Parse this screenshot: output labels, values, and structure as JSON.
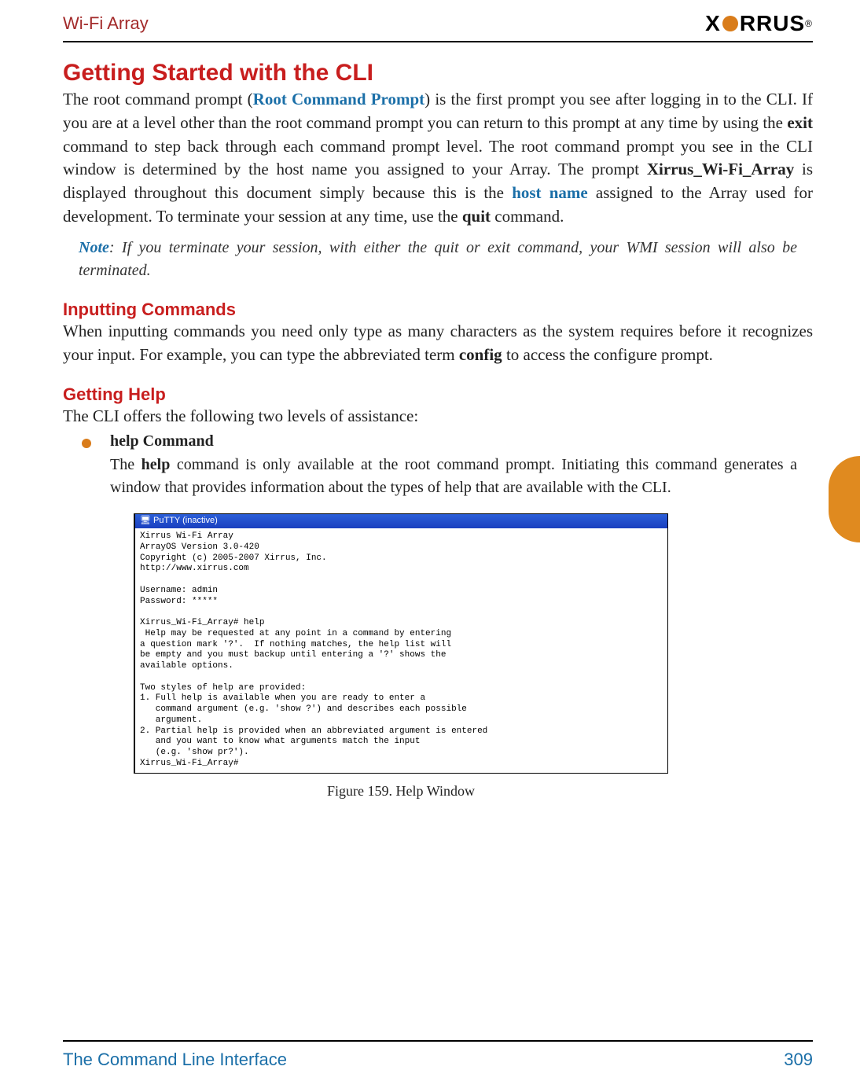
{
  "header": {
    "product": "Wi-Fi Array",
    "logo_text_left": "X",
    "logo_text_right": "RRUS",
    "logo_tm": "®"
  },
  "h1": "Getting Started with the CLI",
  "p1_a": "The root command prompt (",
  "p1_link1": "Root Command Prompt",
  "p1_b": ") is the first prompt you see after logging in to the CLI. If you are at a level other than the root command prompt you can return to this prompt at any time by using the ",
  "p1_bold1": "exit",
  "p1_c": " command to step back through each command prompt level. The root command prompt you see in the CLI window is determined by the host name you assigned to your Array. The prompt ",
  "p1_bold2": "Xirrus_Wi-Fi_Array",
  "p1_d": " is displayed throughout this document simply because this is the ",
  "p1_link2": "host name",
  "p1_e": " assigned to the Array used for development. To terminate your session at any time, use the ",
  "p1_bold3": "quit",
  "p1_f": " command.",
  "note_label": "Note",
  "note_text": ": If you terminate your session, with either the quit or exit command, your WMI session will also be terminated.",
  "h2a": "Inputting Commands",
  "p2_a": "When inputting commands you need only type as many characters as the system requires before it recognizes your input. For example, you can type the abbreviated term ",
  "p2_bold": "config",
  "p2_b": " to access the configure prompt.",
  "h2b": "Getting Help",
  "p3": "The CLI offers the following two levels of assistance:",
  "bullet1_title": "help Command",
  "bullet1_a": "The ",
  "bullet1_bold": "help",
  "bullet1_b": " command is only available at the root command prompt. Initiating this command generates a window that provides information about the types of help that are available with the CLI.",
  "terminal": {
    "titlebar": "PuTTY (inactive)",
    "content": "Xirrus Wi-Fi Array\nArrayOS Version 3.0-420\nCopyright (c) 2005-2007 Xirrus, Inc.\nhttp://www.xirrus.com\n\nUsername: admin\nPassword: *****\n\nXirrus_Wi-Fi_Array# help\n Help may be requested at any point in a command by entering\na question mark '?'.  If nothing matches, the help list will\nbe empty and you must backup until entering a '?' shows the\navailable options.\n\nTwo styles of help are provided:\n1. Full help is available when you are ready to enter a\n   command argument (e.g. 'show ?') and describes each possible\n   argument.\n2. Partial help is provided when an abbreviated argument is entered\n   and you want to know what arguments match the input\n   (e.g. 'show pr?').\nXirrus_Wi-Fi_Array#"
  },
  "fig_caption": "Figure 159. Help Window",
  "footer": {
    "section": "The Command Line Interface",
    "page": "309"
  }
}
